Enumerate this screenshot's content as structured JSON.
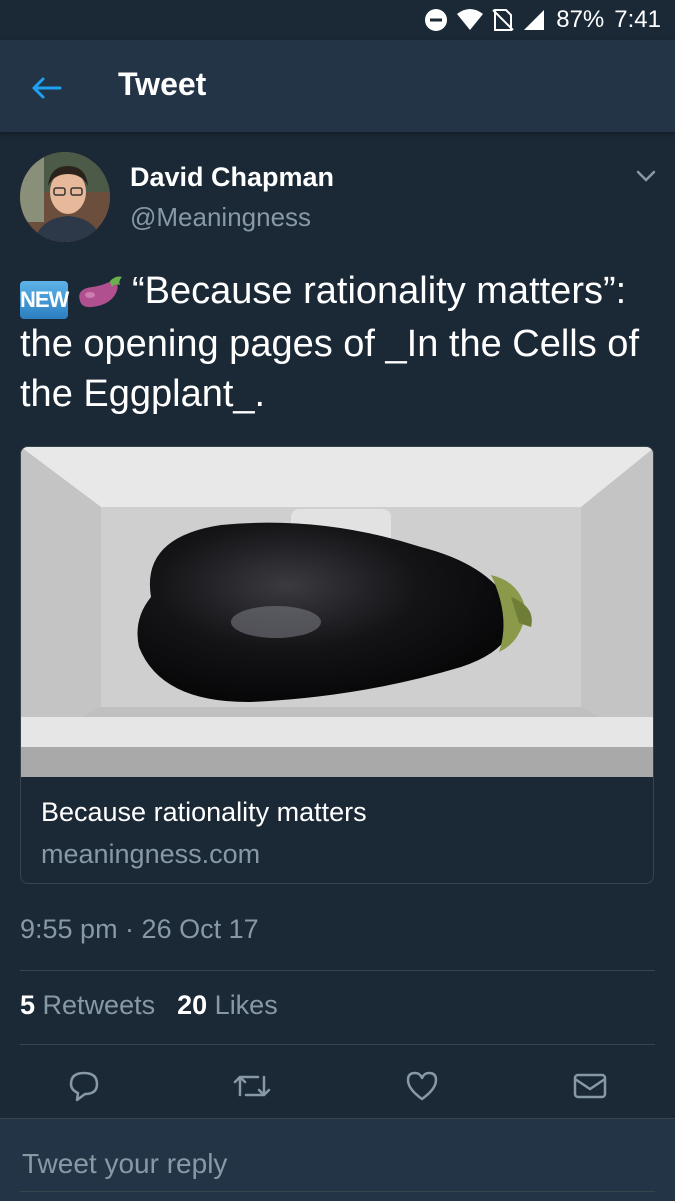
{
  "status_bar": {
    "battery": "87%",
    "time": "7:41"
  },
  "app_bar": {
    "title": "Tweet"
  },
  "tweet": {
    "author_name": "David Chapman",
    "author_handle": "@Meaningness",
    "badge": "NEW",
    "text": "“Because rationality matters”: the opening pages of _In the Cells of the Eggplant_.",
    "card": {
      "title": "Because rationality matters",
      "domain": "meaningness.com"
    },
    "timestamp": "9:55 pm · 26 Oct 17",
    "retweets_count": "5",
    "retweets_label": "Retweets",
    "likes_count": "20",
    "likes_label": "Likes"
  },
  "reply": {
    "placeholder": "Tweet your reply"
  },
  "colors": {
    "background": "#1b2836",
    "bar": "#243447",
    "accent": "#1da1f2",
    "muted": "#8899a6"
  },
  "icons": [
    "dnd-icon",
    "wifi-icon",
    "no-sim-icon",
    "signal-icon",
    "back-arrow-icon",
    "chevron-down-icon",
    "reply-icon",
    "retweet-icon",
    "like-icon",
    "message-icon"
  ]
}
